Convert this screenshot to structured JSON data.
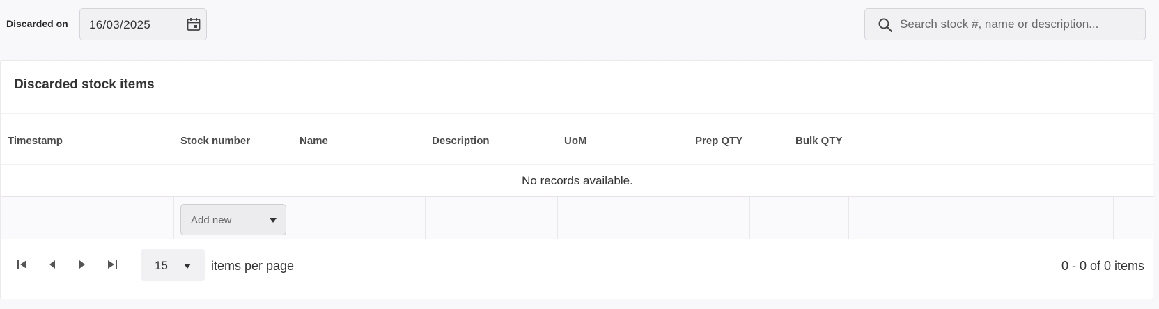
{
  "filter": {
    "label": "Discarded on",
    "date_value": "16/03/2025"
  },
  "search": {
    "placeholder": "Search stock #, name or description..."
  },
  "card": {
    "title": "Discarded stock items"
  },
  "table": {
    "columns": [
      "Timestamp",
      "Stock number",
      "Name",
      "Description",
      "UoM",
      "Prep QTY",
      "Bulk QTY"
    ],
    "empty_message": "No records available.",
    "add_new_label": "Add new"
  },
  "pager": {
    "page_size": "15",
    "items_per_page_label": "items per page",
    "range_text": "0 - 0 of 0 items"
  },
  "icons": {
    "calendar": "calendar-icon",
    "search": "search-icon",
    "first": "page-first-icon",
    "prev": "page-prev-icon",
    "next": "page-next-icon",
    "last": "page-last-icon",
    "dropdown": "chevron-down-icon"
  },
  "colors": {
    "background": "#f8f7fa",
    "card": "#ffffff",
    "input_bg": "#f1f0f3",
    "border": "#d6d4da",
    "text": "#333333"
  }
}
